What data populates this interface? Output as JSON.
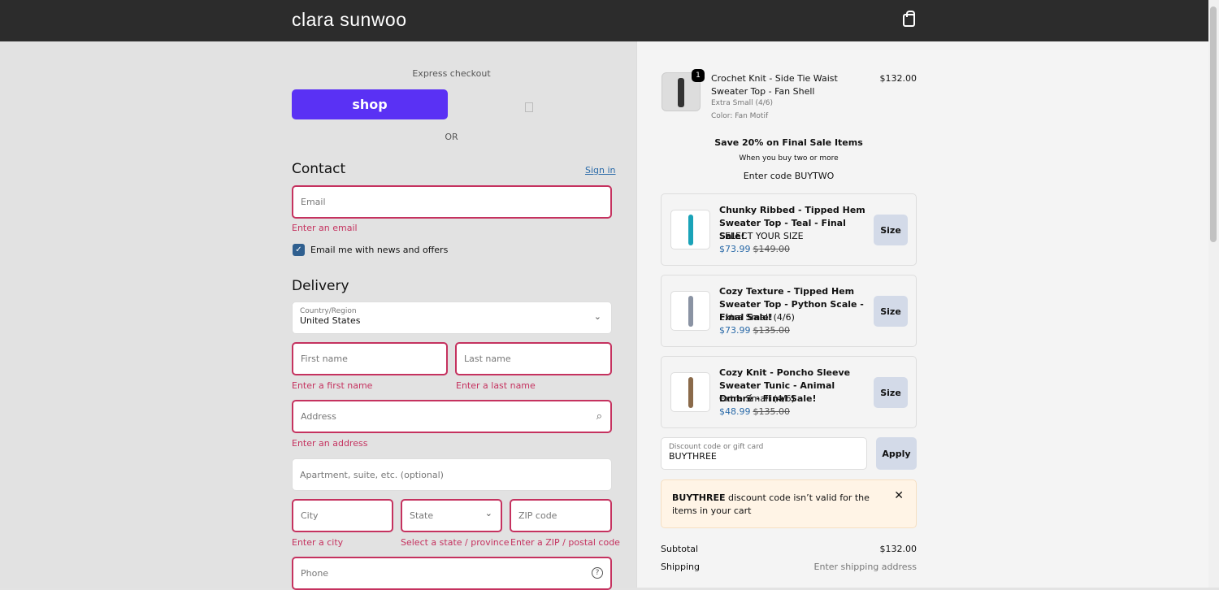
{
  "header": {
    "logo": "clara sunwoo",
    "cart_icon": "shopping-bag-icon"
  },
  "express": {
    "label": "Express checkout",
    "shop_label": "shop",
    "or_label": "OR"
  },
  "contact": {
    "title": "Contact",
    "sign_in": "Sign in",
    "email_placeholder": "Email",
    "email_error": "Enter an email",
    "newsletter_label": "Email me with news and offers",
    "newsletter_checked": true
  },
  "delivery": {
    "title": "Delivery",
    "country_label": "Country/Region",
    "country_value": "United States",
    "first_name": "First name",
    "first_name_error": "Enter a first name",
    "last_name": "Last name",
    "last_name_error": "Enter a last name",
    "address": "Address",
    "address_error": "Enter an address",
    "apartment": "Apartment, suite, etc. (optional)",
    "city": "City",
    "city_error": "Enter a city",
    "state": "State",
    "state_error": "Select a state / province",
    "zip": "ZIP code",
    "zip_error": "Enter a ZIP / postal code",
    "phone": "Phone"
  },
  "cart_item": {
    "quantity": "1",
    "title": "Crochet Knit - Side Tie Waist Sweater Top - Fan Shell",
    "size": "Extra Small (4/6)",
    "color": "Color: Fan Motif",
    "price": "$132.00"
  },
  "promo": {
    "title": "Save 20% on Final Sale Items",
    "subtitle": "When you buy two or more",
    "code": "Enter code BUYTWO"
  },
  "upsells": [
    {
      "title": "Chunky Ribbed - Tipped Hem Sweater Top - Teal - Final Sale!",
      "sub": "SELECT YOUR SIZE",
      "price": "$73.99",
      "old_price": "$149.00",
      "button": "Size",
      "color": "#1aa3b8"
    },
    {
      "title": "Cozy Texture - Tipped Hem Sweater Top - Python Scale - Final Sale!",
      "sub": "Extra Small (4/6)",
      "price": "$73.99",
      "old_price": "$135.00",
      "button": "Size",
      "color": "#8a93a3"
    },
    {
      "title": "Cozy Knit - Poncho Sleeve Sweater Tunic - Animal Ombré - Final Sale!",
      "sub": "Extra Small (4/6)",
      "price": "$48.99",
      "old_price": "$135.00",
      "button": "Size",
      "color": "#8a6a4a"
    }
  ],
  "discount": {
    "label": "Discount code or gift card",
    "value": "BUYTHREE",
    "apply": "Apply"
  },
  "alert": {
    "code": "BUYTHREE",
    "message": " discount code isn’t valid for the items in your cart"
  },
  "summary": {
    "subtotal_label": "Subtotal",
    "subtotal": "$132.00",
    "shipping_label": "Shipping",
    "shipping": "Enter shipping address"
  }
}
